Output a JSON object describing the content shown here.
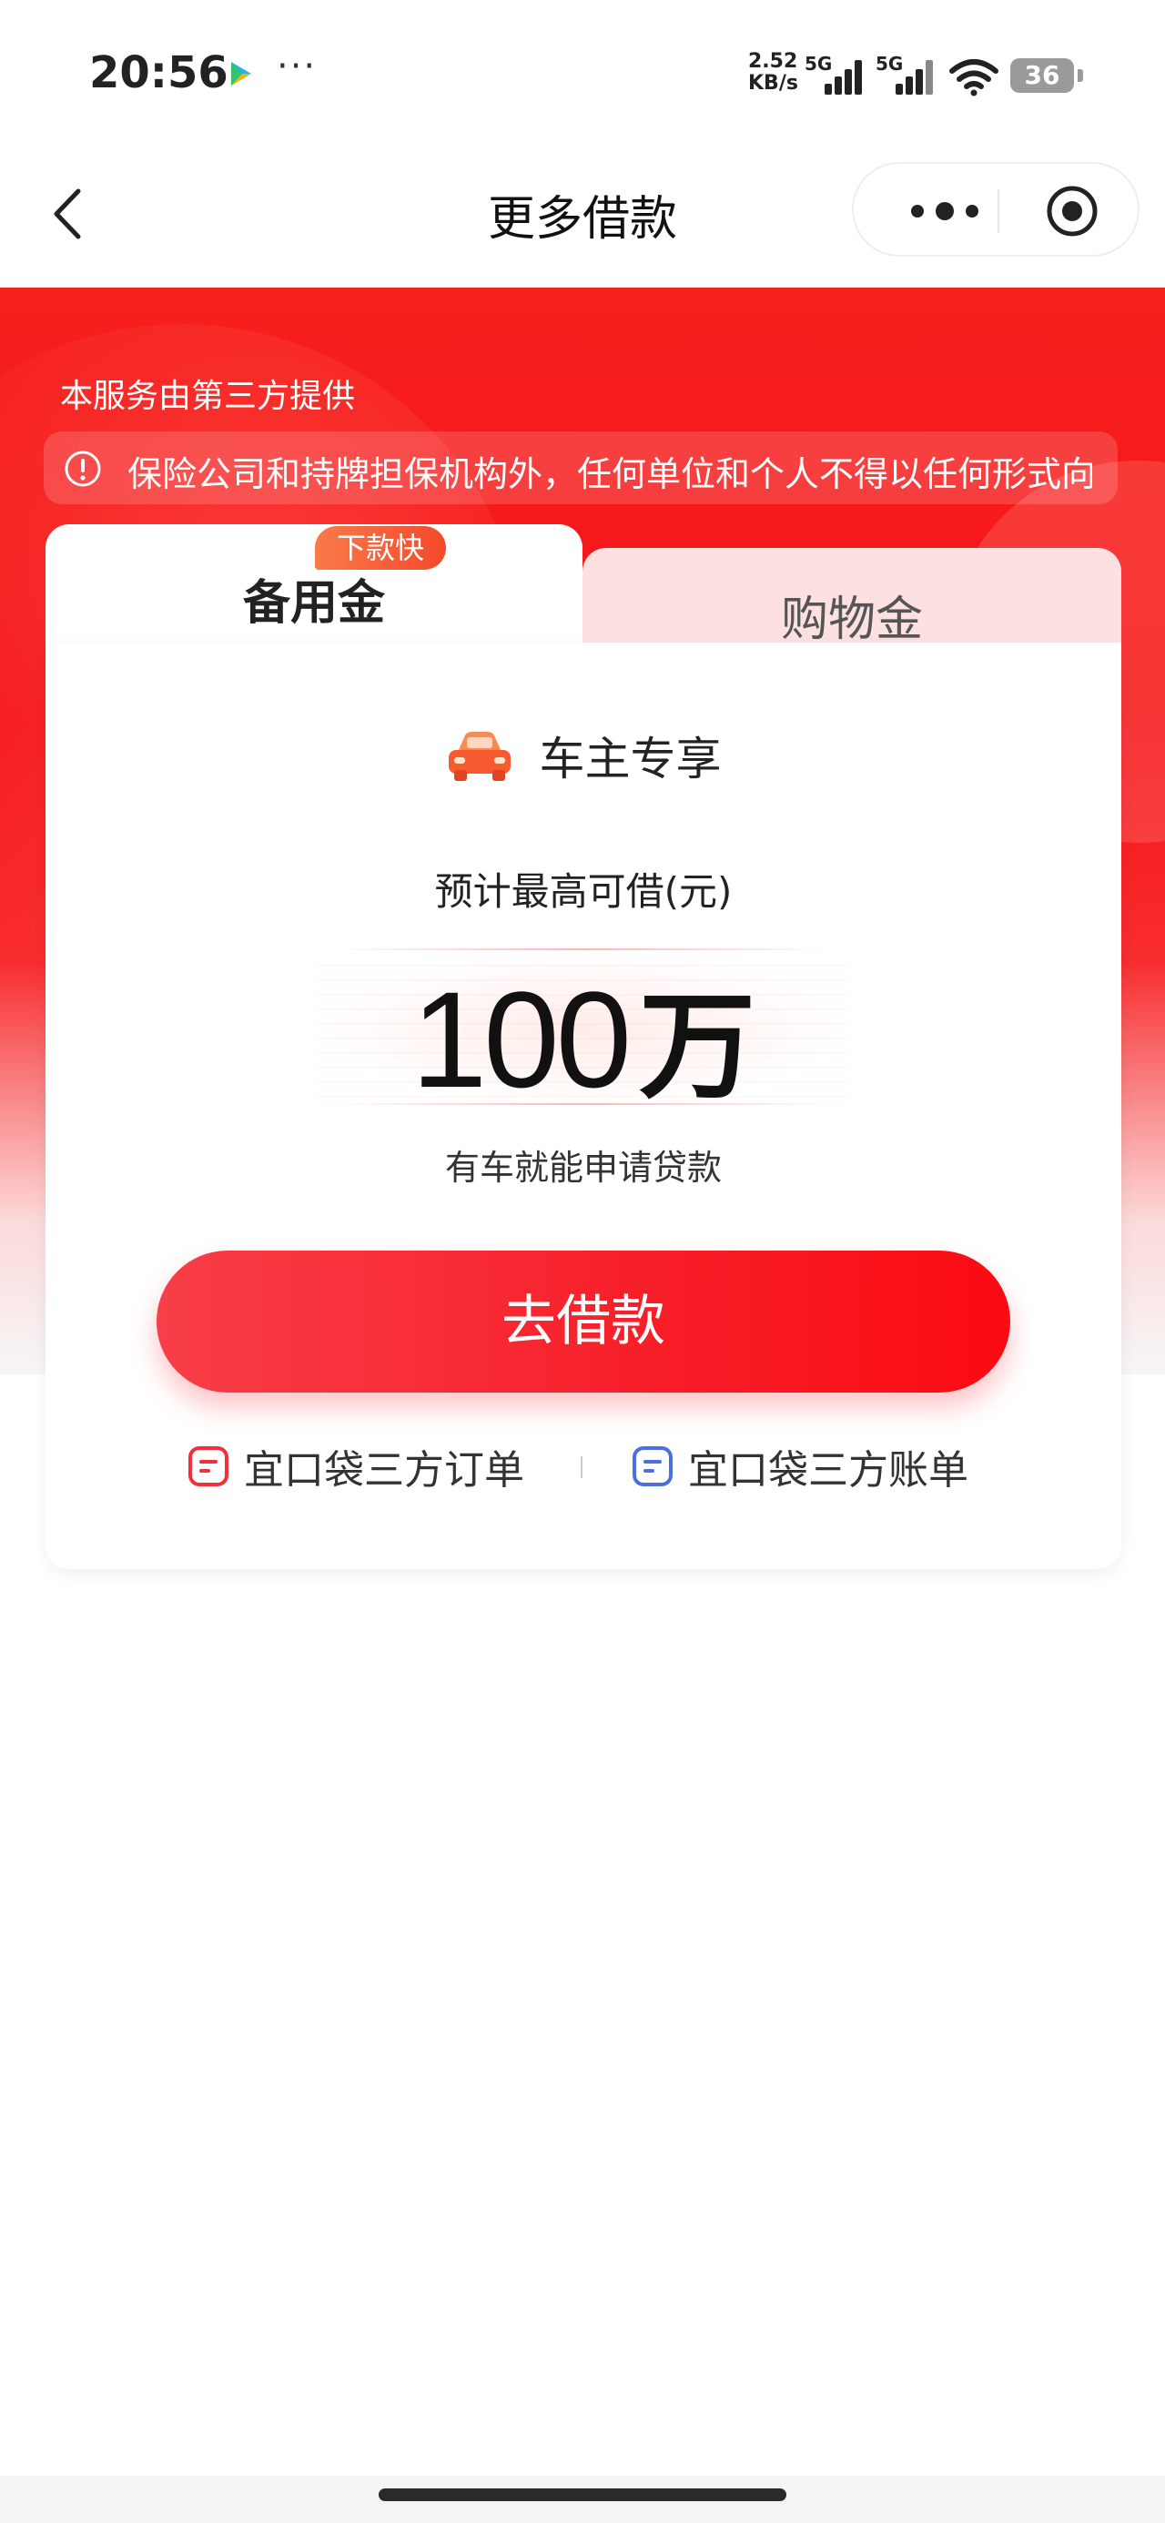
{
  "status_bar": {
    "time": "20:56",
    "more": "···",
    "speed_value": "2.52",
    "speed_unit": "KB/s",
    "sim1_label": "5G",
    "sim2_label": "5G",
    "battery": "36",
    "icons": [
      "play-store-icon",
      "signal-icon",
      "wifi-icon",
      "battery-icon"
    ]
  },
  "nav": {
    "title": "更多借款",
    "icons": [
      "back-arrow-icon",
      "more-dots-icon",
      "target-close-icon"
    ]
  },
  "hero": {
    "service_note": "本服务由第三方提供",
    "notice": "保险公司和持牌担保机构外，任何单位和个人不得以任何形式向"
  },
  "tabs": [
    {
      "label": "备用金",
      "badge": "下款快",
      "active": true
    },
    {
      "label": "购物金",
      "active": false
    }
  ],
  "offer": {
    "tag": "车主专享",
    "limit_label": "预计最高可借(元)",
    "amount_number": "100",
    "amount_unit": "万",
    "subtext": "有车就能申请贷款",
    "cta": "去借款"
  },
  "links": [
    {
      "label": "宜口袋三方订单",
      "icon": "order-icon",
      "color": "#f0303a"
    },
    {
      "label": "宜口袋三方账单",
      "icon": "bill-icon",
      "color": "#4a6fe0"
    }
  ],
  "colors": {
    "brand_red": "#f7202a",
    "tab_inactive_bg": "#fde1e1",
    "badge_orange": "#f5603a"
  }
}
